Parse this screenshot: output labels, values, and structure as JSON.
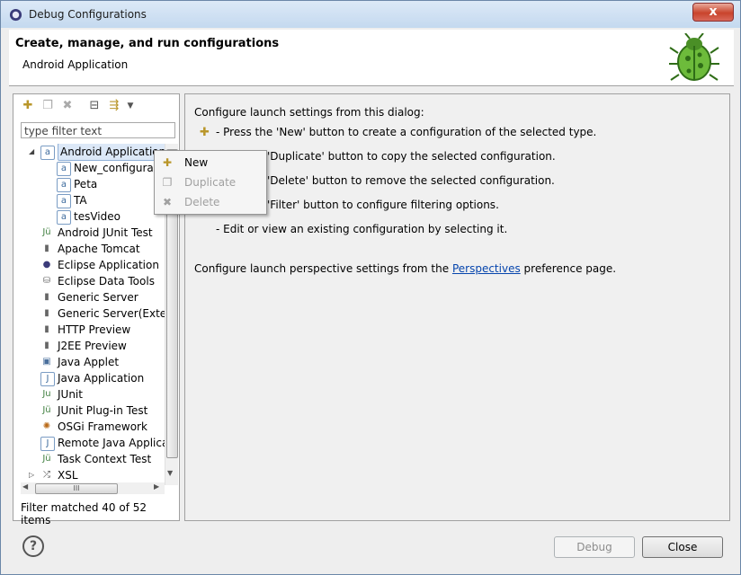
{
  "window": {
    "title": "Debug Configurations",
    "close_label": "x"
  },
  "header": {
    "title": "Create, manage, and run configurations",
    "subtitle": "Android Application"
  },
  "toolbar": {
    "new_icon": "new-config-icon",
    "duplicate_icon": "duplicate-icon",
    "delete_icon": "delete-icon",
    "collapse_icon": "collapse-all-icon",
    "filter_icon": "filter-icon"
  },
  "filter": {
    "placeholder": "type filter text"
  },
  "tree": {
    "items": [
      {
        "label": "Android Application",
        "icon": "android-app-icon",
        "level": 0,
        "expanded": true,
        "selected": true
      },
      {
        "label": "New_configuration",
        "icon": "android-config-icon",
        "level": 1
      },
      {
        "label": "Peta",
        "icon": "android-config-icon",
        "level": 1
      },
      {
        "label": "TA",
        "icon": "android-config-icon",
        "level": 1
      },
      {
        "label": "tesVideo",
        "icon": "android-config-icon",
        "level": 1
      },
      {
        "label": "Android JUnit Test",
        "icon": "junit-android-icon",
        "level": 0
      },
      {
        "label": "Apache Tomcat",
        "icon": "server-icon",
        "level": 0
      },
      {
        "label": "Eclipse Application",
        "icon": "eclipse-icon",
        "level": 0
      },
      {
        "label": "Eclipse Data Tools",
        "icon": "database-icon",
        "level": 0
      },
      {
        "label": "Generic Server",
        "icon": "server-icon",
        "level": 0
      },
      {
        "label": "Generic Server(External",
        "icon": "server-icon",
        "level": 0
      },
      {
        "label": "HTTP Preview",
        "icon": "server-icon",
        "level": 0
      },
      {
        "label": "J2EE Preview",
        "icon": "server-icon",
        "level": 0
      },
      {
        "label": "Java Applet",
        "icon": "applet-icon",
        "level": 0
      },
      {
        "label": "Java Application",
        "icon": "java-app-icon",
        "level": 0
      },
      {
        "label": "JUnit",
        "icon": "junit-icon",
        "level": 0
      },
      {
        "label": "JUnit Plug-in Test",
        "icon": "junit-plugin-icon",
        "level": 0
      },
      {
        "label": "OSGi Framework",
        "icon": "osgi-icon",
        "level": 0
      },
      {
        "label": "Remote Java Applicat",
        "icon": "remote-java-icon",
        "level": 0
      },
      {
        "label": "Task Context Test",
        "icon": "task-context-icon",
        "level": 0
      },
      {
        "label": "XSL",
        "icon": "xsl-icon",
        "level": 0,
        "collapsed": true
      }
    ]
  },
  "status": {
    "filter_text": "Filter matched 40 of 52 items"
  },
  "context_menu": {
    "items": [
      {
        "label": "New",
        "icon": "new-config-icon",
        "enabled": true
      },
      {
        "label": "Duplicate",
        "icon": "duplicate-icon",
        "enabled": false
      },
      {
        "label": "Delete",
        "icon": "delete-icon",
        "enabled": false
      }
    ]
  },
  "right_panel": {
    "intro": "Configure launch settings from this dialog:",
    "bullet_new": "- Press the 'New' button to create a configuration of the selected type.",
    "bullet_dup": "'Duplicate' button to copy the selected configuration.",
    "bullet_del": "'Delete' button to remove the selected configuration.",
    "bullet_filter": "'Filter' button to configure filtering options.",
    "bullet_edit": "- Edit or view an existing configuration by selecting it.",
    "perspective_pre": "Configure launch perspective settings from the",
    "perspective_link": "Perspectives",
    "perspective_post": "preference page."
  },
  "buttons": {
    "debug": "Debug",
    "close": "Close",
    "help": "?"
  }
}
